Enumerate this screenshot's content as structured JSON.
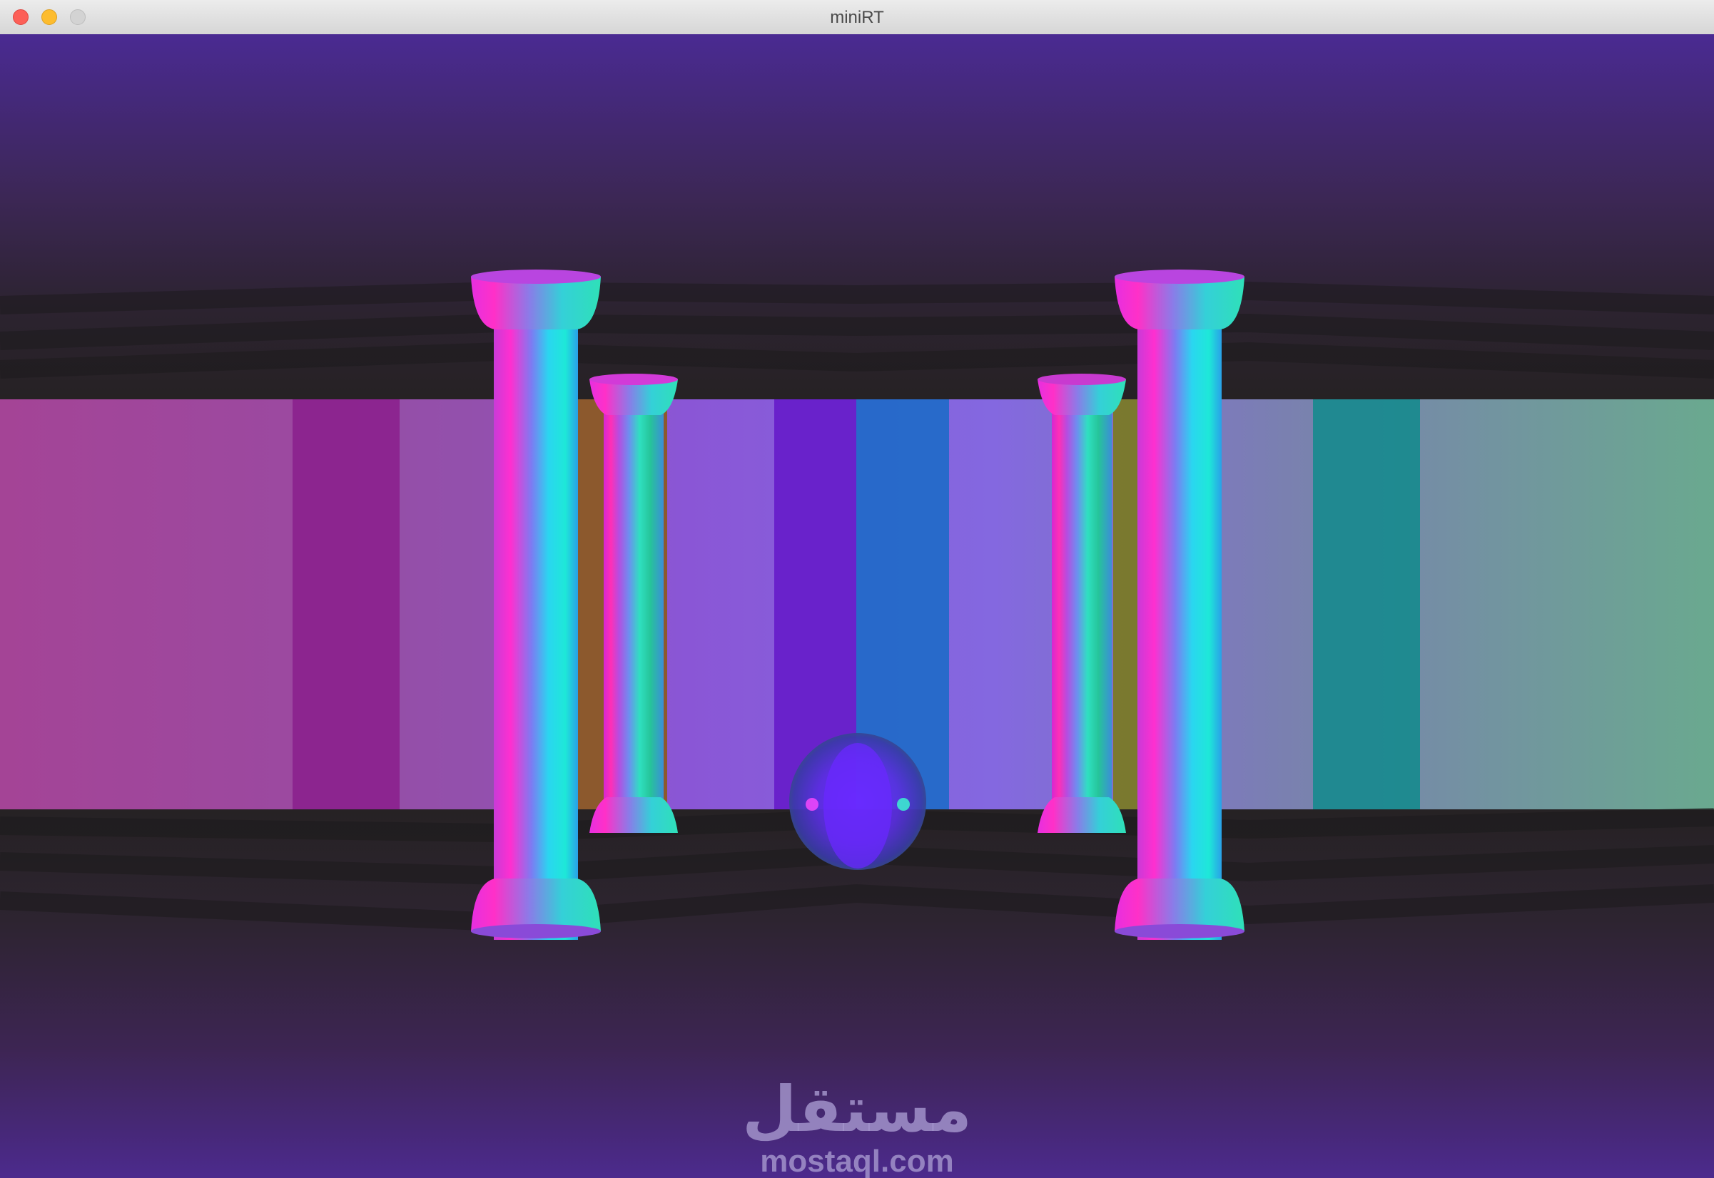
{
  "window": {
    "title": "miniRT",
    "controls": {
      "close": "close-button",
      "minimize": "minimize-button",
      "maximize": "maximize-button"
    }
  },
  "scene": {
    "sky_color_top": "#49288f",
    "sky_color_horizon": "#2a2227",
    "floor_color_bottom": "#4a2a8c",
    "wall_gradient_left": "#a5449a",
    "wall_gradient_right": "#6aa98f"
  },
  "watermark": {
    "arabic": "مستقل",
    "latin": "mostaql.com"
  }
}
